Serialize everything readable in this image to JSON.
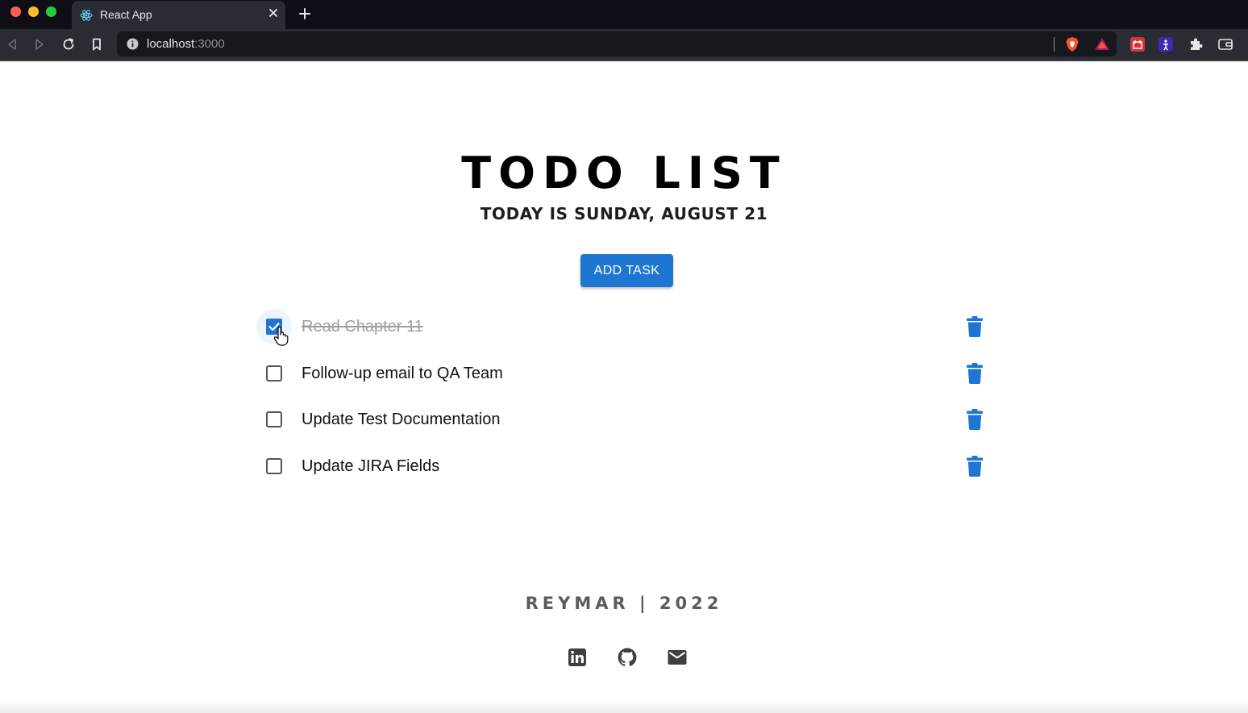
{
  "browser": {
    "tab_title": "React App",
    "url_host": "localhost",
    "url_port": ":3000"
  },
  "header": {
    "title": "TODO LIST",
    "date_line": "TODAY IS SUNDAY, AUGUST 21"
  },
  "actions": {
    "add_task_label": "ADD TASK"
  },
  "tasks": [
    {
      "text": "Read Chapter 11",
      "done": true
    },
    {
      "text": "Follow-up email to QA Team",
      "done": false
    },
    {
      "text": "Update Test Documentation",
      "done": false
    },
    {
      "text": "Update JIRA Fields",
      "done": false
    }
  ],
  "footer": {
    "signature": "REYMAR | 2022",
    "links": [
      "linkedin-icon",
      "github-icon",
      "email-icon"
    ]
  },
  "colors": {
    "accent": "#1f76d2",
    "done_text": "#9e9e9e",
    "footer_text": "#5b5b5b",
    "chrome_bg": "#0d0e16"
  }
}
